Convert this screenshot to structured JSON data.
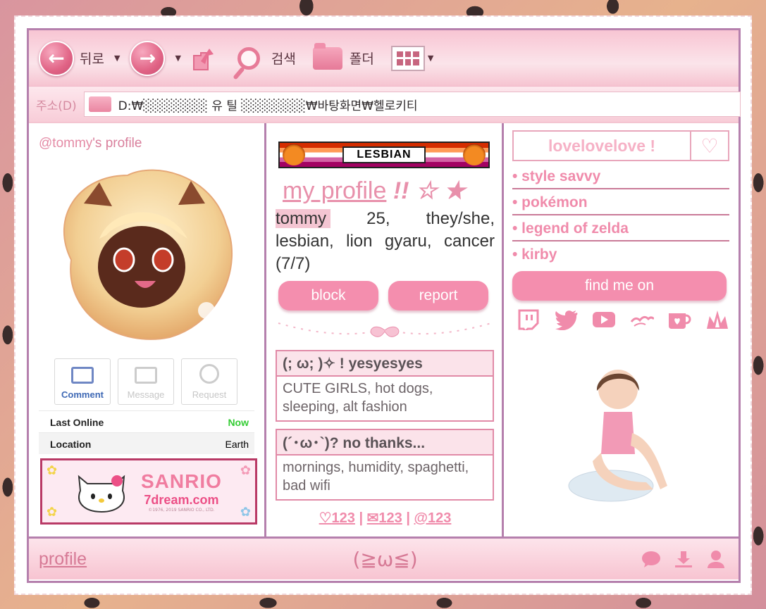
{
  "toolbar": {
    "back_label": "뒤로",
    "search_label": "검색",
    "folder_label": "폴더"
  },
  "address": {
    "label": "주소(D)",
    "path": "D:₩░░░░░░░ 유 틸 ░░░░░░░₩바탕화면₩헬로키티"
  },
  "left": {
    "handle_user": "@tommy",
    "handle_suffix": "'s profile",
    "actions": [
      {
        "label": "Comment",
        "state": "active"
      },
      {
        "label": "Message",
        "state": "disabled"
      },
      {
        "label": "Request",
        "state": "disabled"
      }
    ],
    "info": [
      {
        "key": "Last Online",
        "value": "Now"
      },
      {
        "key": "Location",
        "value": "Earth"
      }
    ],
    "banner": {
      "brand": "SANRIO",
      "site": "7dream.com",
      "copyright": "©1976, 2019 SANRIO CO., LTD."
    }
  },
  "middle": {
    "flag_text": "LESBIAN",
    "title": "my profile",
    "title_suffix": " !! ☆ ★",
    "bio_name": "tommy",
    "bio_rest": " 25, they/she, lesbian, lion gyaru, cancer (7/7)",
    "block_label": "block",
    "report_label": "report",
    "yes_head": "(; ω; )✧ ! yesyesyes",
    "yes_body": "CUTE GIRLS, hot dogs, sleeping, alt fashion",
    "no_head": "(´･ω･`)? no thanks...",
    "no_body": "mornings, humidity, spaghetti, bad wifi",
    "stats": {
      "likes": "123",
      "messages": "123",
      "mentions": "@123"
    }
  },
  "right": {
    "love_text": "lovelovelove !",
    "items": [
      "• style savvy",
      "• pokémon",
      "• legend of zelda",
      "• kirby"
    ],
    "find_label": "find me on",
    "socials": [
      "twitch-icon",
      "twitter-icon",
      "youtube-icon",
      "bird-icon",
      "kofi-icon",
      "crown-icon"
    ]
  },
  "footer": {
    "link": "profile",
    "face": "(≧ω≦)"
  },
  "colors": {
    "accent": "#f48eae",
    "border": "#b580ad",
    "text_pink": "#f08bab"
  }
}
